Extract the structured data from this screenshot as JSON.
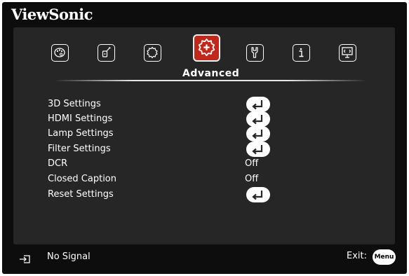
{
  "brand": "ViewSonic",
  "tabs": [
    {
      "icon": "palette-icon",
      "active": false
    },
    {
      "icon": "tool-brush-icon",
      "active": false
    },
    {
      "icon": "gear-icon",
      "active": false
    },
    {
      "icon": "gear-plus-icon",
      "active": true,
      "label": "Advanced"
    },
    {
      "icon": "wrench-icon",
      "active": false
    },
    {
      "icon": "info-icon",
      "active": false
    },
    {
      "icon": "projector-screen-icon",
      "active": false
    }
  ],
  "active_tab_label": "Advanced",
  "menu_items": [
    {
      "label": "3D Settings",
      "type": "enter"
    },
    {
      "label": "HDMI Settings",
      "type": "enter"
    },
    {
      "label": "Lamp Settings",
      "type": "enter"
    },
    {
      "label": "Filter Settings",
      "type": "enter"
    },
    {
      "label": "DCR",
      "type": "value",
      "value": "Off"
    },
    {
      "label": "Closed Caption",
      "type": "value",
      "value": "Off"
    },
    {
      "label": "Reset Settings",
      "type": "enter"
    }
  ],
  "footer": {
    "input_icon": "input-source-icon",
    "status": "No Signal",
    "exit_label": "Exit:",
    "menu_button": "Menu"
  },
  "colors": {
    "background": "#0d0d0d",
    "panel": "#262626",
    "active_tab": "#c0281c",
    "text": "#ffffff"
  }
}
